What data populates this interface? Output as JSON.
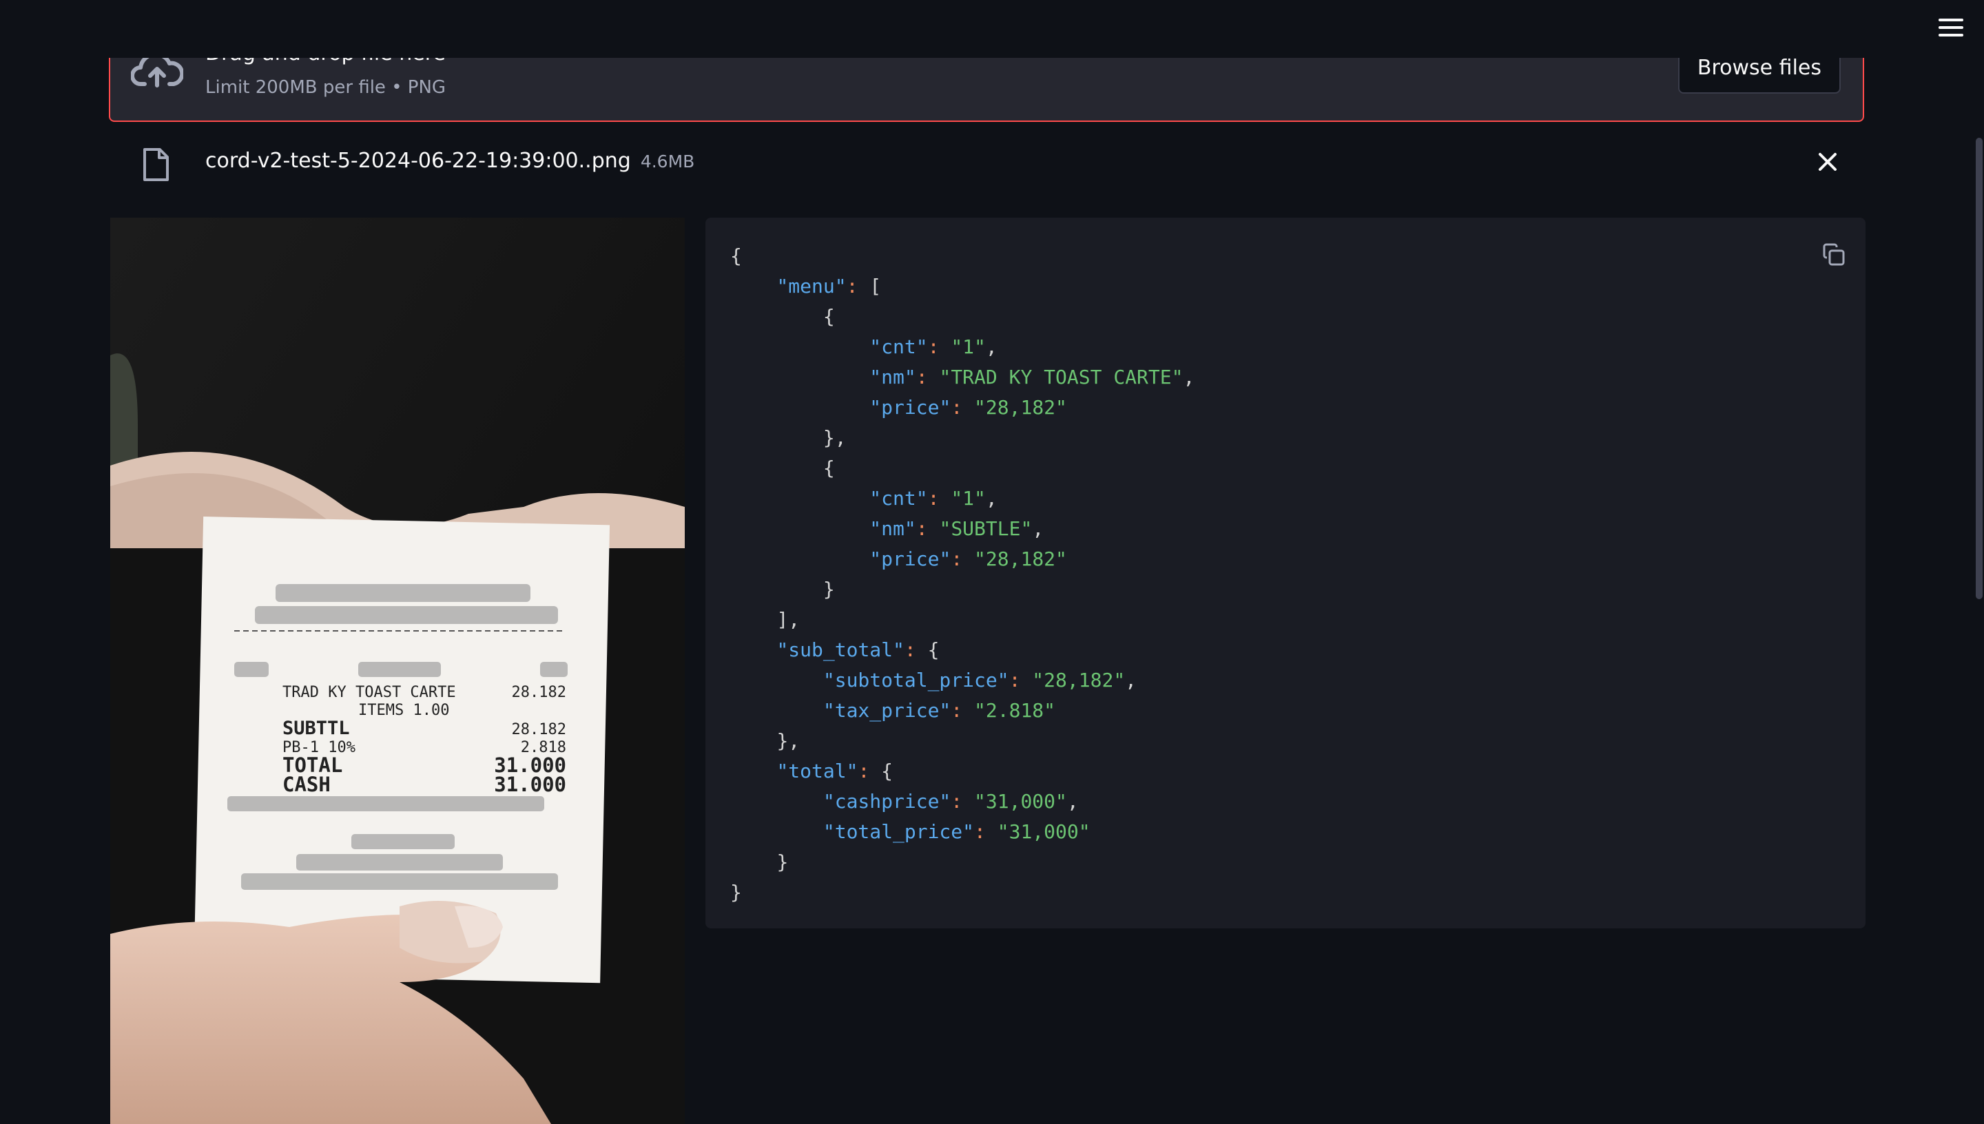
{
  "menu_icon": "hamburger-menu-icon",
  "uploader": {
    "title": "Drag and drop file here",
    "limit": "Limit 200MB per file • PNG",
    "browse_label": "Browse files",
    "icon": "cloud-upload-icon"
  },
  "file": {
    "name": "cord-v2-test-5-2024-06-22-19:39:00..png",
    "size": "4.6MB",
    "icon": "file-icon",
    "remove_icon": "close-icon"
  },
  "receipt": {
    "lines": [
      {
        "label": "TRAD KY TOAST CARTE",
        "value": "28.182"
      },
      {
        "label": "ITEMS 1.00",
        "value": ""
      },
      {
        "label": "SUBTTL",
        "value": "28.182"
      },
      {
        "label": "PB-1 10%",
        "value": "2.818"
      },
      {
        "label": "TOTAL",
        "value": "31.000"
      },
      {
        "label": "CASH",
        "value": "31.000"
      }
    ]
  },
  "json_output": {
    "copy_icon": "copy-icon",
    "menu": [
      {
        "cnt": "1",
        "nm": "TRAD KY TOAST CARTE",
        "price": "28,182"
      },
      {
        "cnt": "1",
        "nm": "SUBTLE",
        "price": "28,182"
      }
    ],
    "sub_total": {
      "subtotal_price": "28,182",
      "tax_price": "2.818"
    },
    "total": {
      "cashprice": "31,000",
      "total_price": "31,000"
    }
  }
}
